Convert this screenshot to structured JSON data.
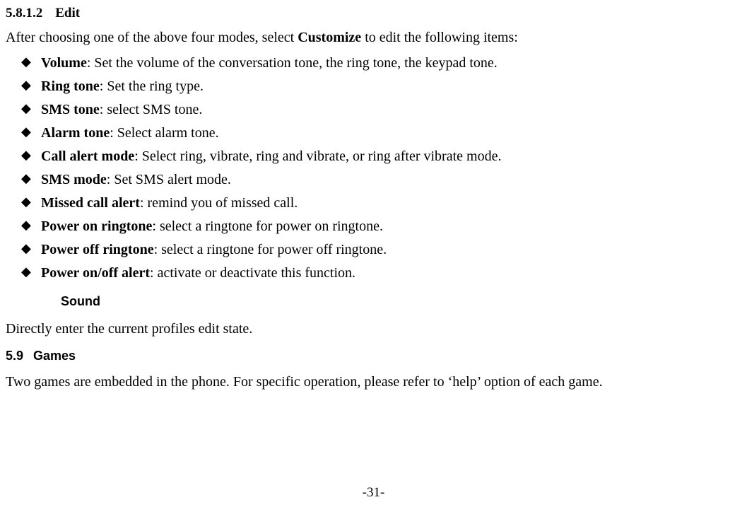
{
  "section_heading": {
    "number": "5.8.1.2",
    "title": "Edit"
  },
  "intro": {
    "before": "After choosing one of the above four modes, select ",
    "bold": "Customize",
    "after": " to edit the following items:"
  },
  "items": [
    {
      "term": "Volume",
      "desc": ": Set the volume of the conversation tone, the ring tone, the keypad tone."
    },
    {
      "term": "Ring tone",
      "desc": ": Set the ring type."
    },
    {
      "term": "SMS tone",
      "desc": ": select SMS tone."
    },
    {
      "term": "Alarm tone",
      "desc": ": Select alarm tone."
    },
    {
      "term": "Call alert mode",
      "desc": ": Select ring, vibrate, ring and vibrate, or ring after vibrate mode."
    },
    {
      "term": "SMS mode",
      "desc": ": Set SMS alert mode."
    },
    {
      "term": "Missed call alert",
      "desc": ": remind you of missed call."
    },
    {
      "term": "Power on ringtone",
      "desc": ": select a ringtone for power on ringtone."
    },
    {
      "term": "Power off ringtone",
      "desc": ": select a ringtone for power off ringtone."
    },
    {
      "term": "Power on/off alert",
      "desc": ": activate or deactivate this function."
    }
  ],
  "sound": {
    "heading": "Sound",
    "text": "Directly enter the current profiles edit state."
  },
  "games": {
    "number": "5.9",
    "heading": "Games",
    "text": "Two games are embedded in the phone. For specific operation, please refer to ‘help’ option of each game."
  },
  "page_number": "-31-"
}
